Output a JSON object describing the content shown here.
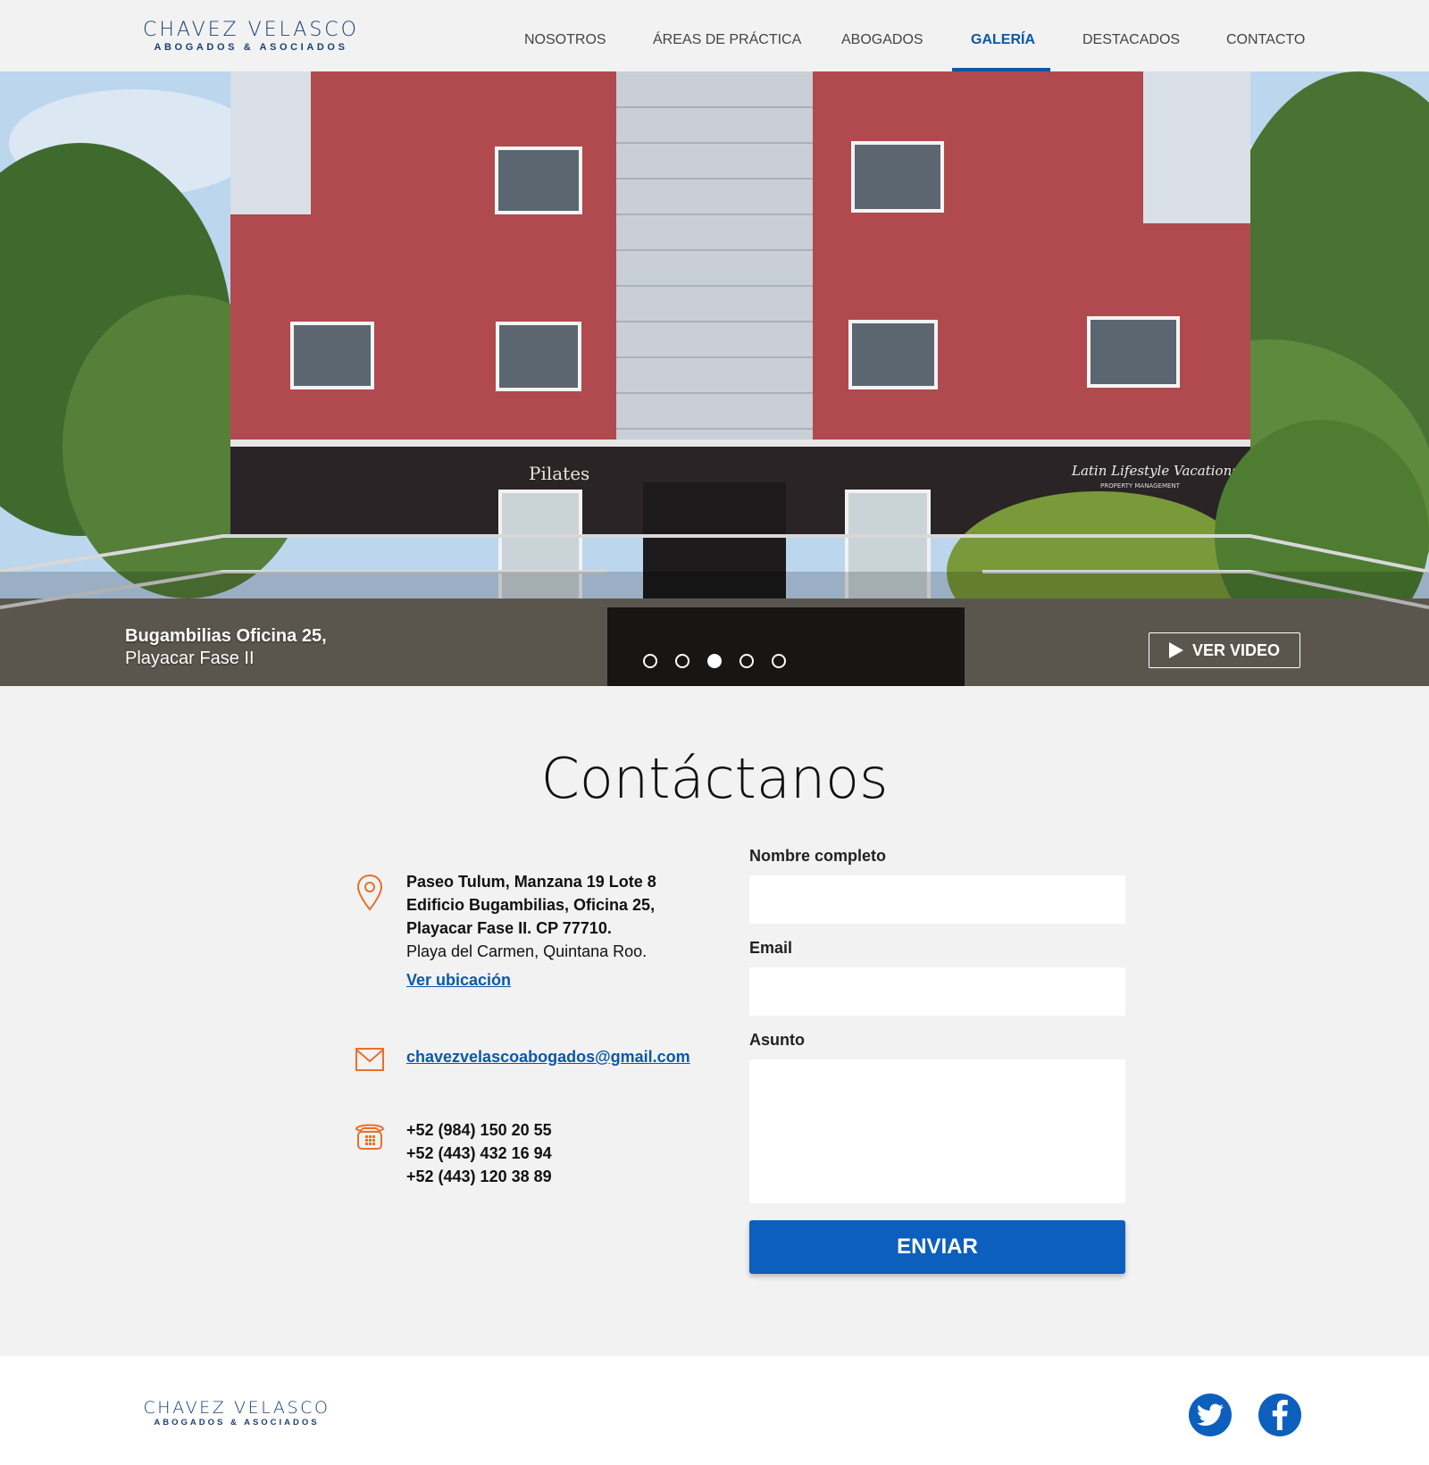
{
  "brand": {
    "name": "CHAVEZ VELASCO",
    "tagline": "ABOGADOS & ASOCIADOS"
  },
  "nav": {
    "items": [
      "NOSOTROS",
      "ÁREAS DE PRÁCTICA",
      "ABOGADOS",
      "GALERÍA",
      "DESTACADOS",
      "CONTACTO"
    ],
    "active": "GALERÍA"
  },
  "hero": {
    "caption_title": "Bugambilias Oficina 25,",
    "caption_subtitle": "Playacar Fase II",
    "slides_total": 5,
    "active_slide": 3,
    "video_button": "VER VIDEO",
    "signs": {
      "studio": "Pilates",
      "shop": "Latin Lifestyle Vacations",
      "shop_sub": "PROPERTY MANAGEMENT"
    }
  },
  "contact": {
    "title": "Contáctanos",
    "address_lines": [
      "Paseo Tulum, Manzana 19 Lote 8",
      "Edificio Bugambilias, Oficina 25,",
      "Playacar Fase II. CP 77710."
    ],
    "city": "Playa del Carmen, Quintana Roo.",
    "map_link": "Ver ubicación",
    "email": "chavezvelascoabogados@gmail.com",
    "phones": [
      "+52 (984) 150 20 55",
      "+52 (443) 432 16 94",
      "+52 (443) 120 38 89"
    ]
  },
  "form": {
    "name_label": "Nombre completo",
    "name_value": "",
    "email_label": "Email",
    "email_value": "",
    "subject_label": "Asunto",
    "subject_value": "",
    "submit_label": "ENVIAR"
  },
  "colors": {
    "accent": "#0d57a8",
    "button": "#0d5fbd",
    "icon": "#e8702a",
    "brand": "#1b3f73"
  },
  "social": [
    "twitter-icon",
    "facebook-icon"
  ]
}
